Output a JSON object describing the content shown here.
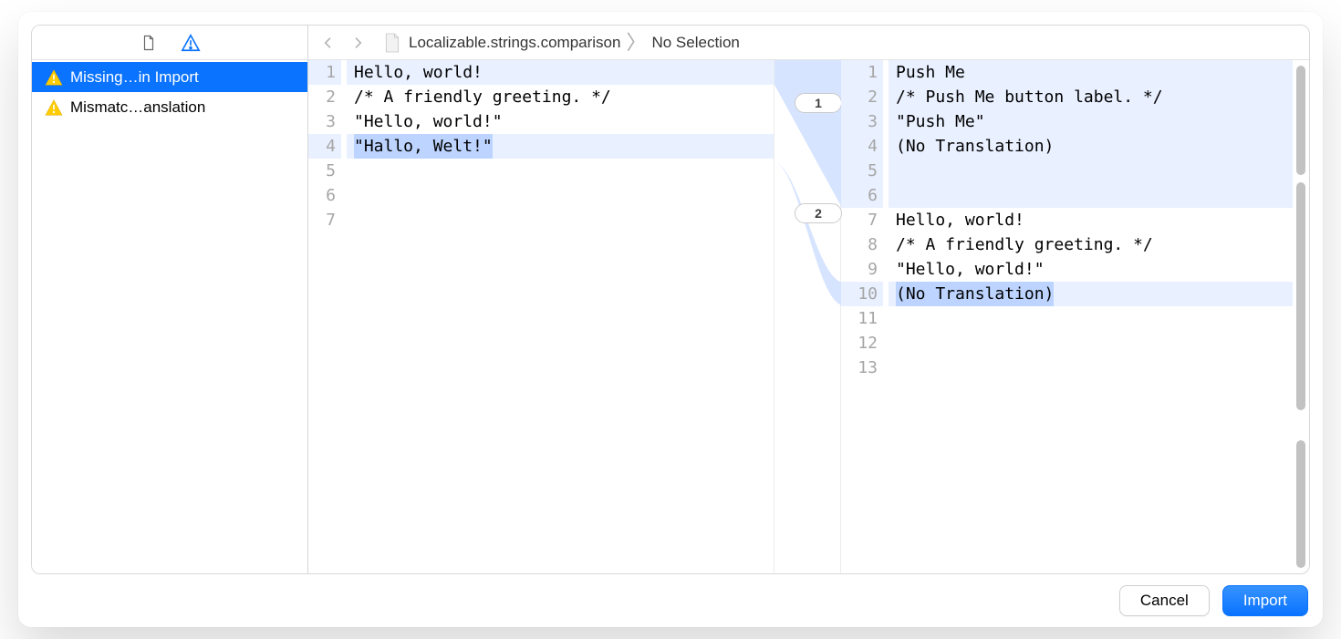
{
  "sidebar": {
    "tabs": {
      "file_active": false,
      "warning_active": true
    },
    "items": [
      {
        "label": "Missing…in Import",
        "selected": true
      },
      {
        "label": "Mismatc…anslation",
        "selected": false
      }
    ]
  },
  "breadcrumb": {
    "file": "Localizable.strings.comparison",
    "selection": "No Selection"
  },
  "diff": {
    "left": {
      "lines": [
        {
          "n": 1,
          "text": "Hello, world!",
          "hl": true
        },
        {
          "n": 2,
          "text": "/* A friendly greeting. */",
          "hl": false
        },
        {
          "n": 3,
          "text": "\"Hello, world!\"",
          "hl": false
        },
        {
          "n": 4,
          "text": "\"Hallo, Welt!\"",
          "hl": true,
          "wordhl": true
        },
        {
          "n": 5,
          "text": "",
          "hl": false
        },
        {
          "n": 6,
          "text": "",
          "hl": false
        },
        {
          "n": 7,
          "text": "",
          "hl": false
        }
      ]
    },
    "right": {
      "lines": [
        {
          "n": 1,
          "text": "Push Me",
          "hl": true
        },
        {
          "n": 2,
          "text": "/* Push Me button label. */",
          "hl": true
        },
        {
          "n": 3,
          "text": "\"Push Me\"",
          "hl": true
        },
        {
          "n": 4,
          "text": "(No Translation)",
          "hl": true
        },
        {
          "n": 5,
          "text": "",
          "hl": true
        },
        {
          "n": 6,
          "text": "",
          "hl": true
        },
        {
          "n": 7,
          "text": "Hello, world!",
          "hl": false
        },
        {
          "n": 8,
          "text": "/* A friendly greeting. */",
          "hl": false
        },
        {
          "n": 9,
          "text": "\"Hello, world!\"",
          "hl": false
        },
        {
          "n": 10,
          "text": "(No Translation)",
          "hl": true,
          "wordhl": true
        },
        {
          "n": 11,
          "text": "",
          "hl": false
        },
        {
          "n": 12,
          "text": "",
          "hl": false
        },
        {
          "n": 13,
          "text": "",
          "hl": false
        }
      ]
    },
    "badges": {
      "b1": "1",
      "b2": "2"
    }
  },
  "footer": {
    "cancel": "Cancel",
    "import": "Import"
  }
}
